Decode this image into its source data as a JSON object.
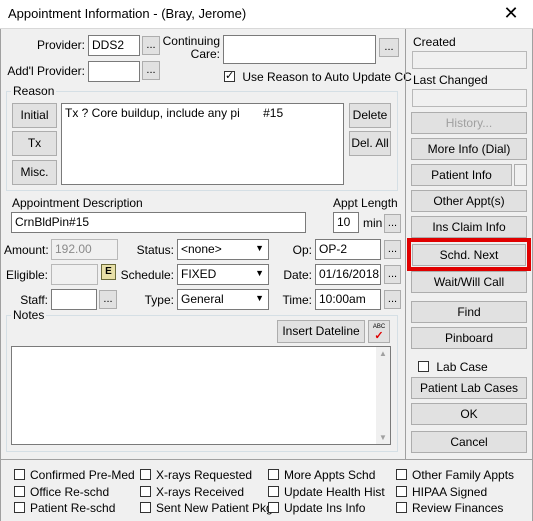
{
  "window": {
    "title": "Appointment Information - (Bray, Jerome)",
    "close_glyph": "✕"
  },
  "provider": {
    "label": "Provider:",
    "value": "DDS2",
    "browse": "..."
  },
  "addl_provider": {
    "label": "Add'l Provider:",
    "value": "",
    "browse": "..."
  },
  "continuing_care": {
    "label_line1": "Continuing",
    "label_line2": "Care:",
    "value": "",
    "browse": "..."
  },
  "use_reason": {
    "label": "Use Reason to Auto Update CC",
    "checked": true
  },
  "reason": {
    "group_label": "Reason",
    "text_line1": "Tx   ?  Core buildup, include any pi",
    "text_tooth": "#15",
    "buttons": {
      "initial": "Initial",
      "tx": "Tx",
      "misc": "Misc.",
      "delete": "Delete",
      "del_all": "Del. All"
    }
  },
  "appt_description": {
    "label": "Appointment Description",
    "value": "CrnBldPin#15"
  },
  "appt_length": {
    "label": "Appt Length",
    "value": "10",
    "unit": "min",
    "browse": "..."
  },
  "amount": {
    "label": "Amount:",
    "value": "192.00"
  },
  "eligible": {
    "label": "Eligible:",
    "value": "",
    "icon": "E"
  },
  "staff": {
    "label": "Staff:",
    "value": "",
    "browse": "..."
  },
  "status": {
    "label": "Status:",
    "value": "<none>"
  },
  "schedule": {
    "label": "Schedule:",
    "value": "FIXED"
  },
  "type": {
    "label": "Type:",
    "value": "General"
  },
  "op": {
    "label": "Op:",
    "value": "OP-2",
    "browse": "..."
  },
  "date": {
    "label": "Date:",
    "value": "01/16/2018",
    "browse": "..."
  },
  "time": {
    "label": "Time:",
    "value": "10:00am",
    "browse": "..."
  },
  "notes": {
    "group_label": "Notes",
    "insert_dateline": "Insert Dateline",
    "spell_icon": "ABC",
    "value": ""
  },
  "right_panel": {
    "created_label": "Created",
    "created_value": "",
    "last_changed_label": "Last Changed",
    "last_changed_value": "",
    "history": "History...",
    "more_info": "More Info (Dial)",
    "patient_info": "Patient Info",
    "other_appts": "Other Appt(s)",
    "ins_claim_info": "Ins Claim Info",
    "schd_next": "Schd. Next",
    "wait_will_call": "Wait/Will Call",
    "find": "Find",
    "pinboard": "Pinboard",
    "lab_case": "Lab Case",
    "patient_lab_cases": "Patient Lab Cases",
    "ok": "OK",
    "cancel": "Cancel"
  },
  "checkboxes": [
    [
      "Confirmed Pre-Med",
      "X-rays Requested",
      "More Appts Schd",
      "Other Family Appts"
    ],
    [
      "Office Re-schd",
      "X-rays Received",
      "Update Health Hist",
      "HIPAA Signed"
    ],
    [
      "Patient Re-schd",
      "Sent New Patient Pkg",
      "Update Ins Info",
      "Review Finances"
    ]
  ],
  "colors": {
    "highlight": "#e00000"
  }
}
